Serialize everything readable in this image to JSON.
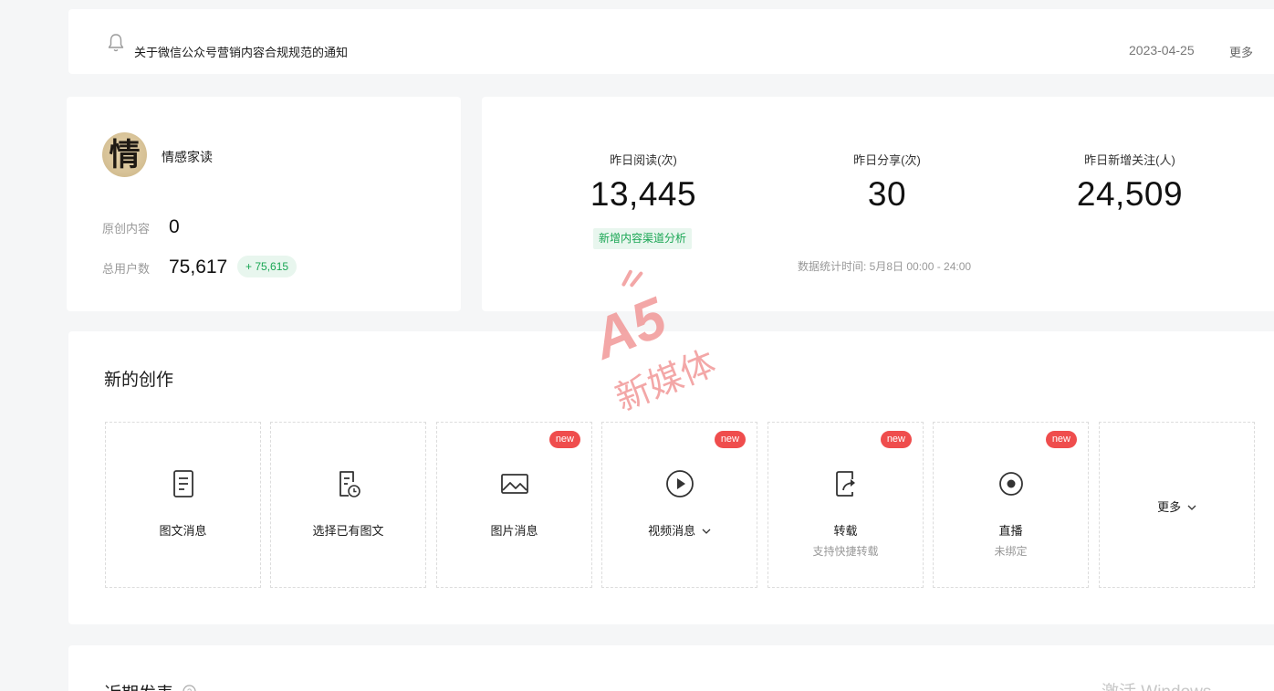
{
  "notice": {
    "text": "关于微信公众号营销内容合规规范的通知",
    "date": "2023-04-25",
    "more": "更多"
  },
  "account": {
    "avatar_char": "情",
    "name": "情感家读",
    "original_label": "原创内容",
    "original_value": "0",
    "users_label": "总用户数",
    "users_value": "75,617",
    "users_growth": "+ 75,615"
  },
  "stats": {
    "reads_label": "昨日阅读(次)",
    "reads_value": "13,445",
    "shares_label": "昨日分享(次)",
    "shares_value": "30",
    "follows_label": "昨日新增关注(人)",
    "follows_value": "24,509",
    "channel_link": "新增内容渠道分析",
    "time_text": "数据统计时间: 5月8日 00:00 - 24:00"
  },
  "create": {
    "title": "新的创作",
    "new_badge": "new",
    "tiles": [
      {
        "label": "图文消息",
        "icon": "document-icon"
      },
      {
        "label": "选择已有图文",
        "icon": "document-clock-icon"
      },
      {
        "label": "图片消息",
        "icon": "image-icon"
      },
      {
        "label": "视频消息",
        "icon": "play-circle-icon"
      },
      {
        "label": "转载",
        "sub": "支持快捷转载",
        "icon": "share-doc-icon"
      },
      {
        "label": "直播",
        "sub": "未绑定",
        "icon": "live-dot-icon"
      },
      {
        "label": "更多",
        "icon": "chevron-down-icon"
      }
    ]
  },
  "recent": {
    "title": "近期发表",
    "win_activate": "激活 Windows"
  },
  "watermark": {
    "logo_text": "A5",
    "sub_text": "新媒体"
  },
  "colors": {
    "accent_green": "#1aa654",
    "badge_red": "#ef4d4d",
    "watermark": "#f08a8a"
  }
}
